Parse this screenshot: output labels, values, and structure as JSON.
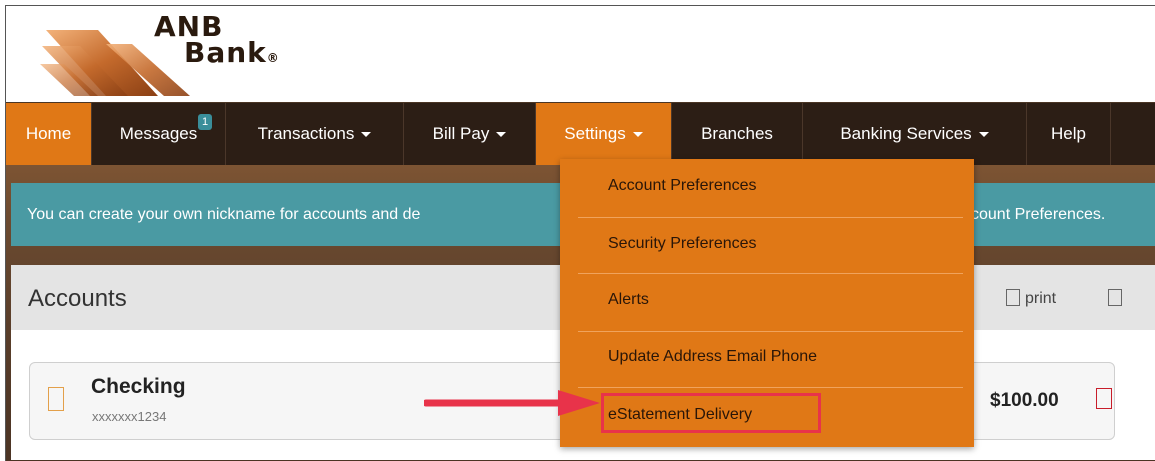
{
  "header": {
    "logo_line1": "ANB",
    "logo_line2": "Bank",
    "logo_reg": "®"
  },
  "nav": {
    "home": "Home",
    "messages": "Messages",
    "messages_badge": "1",
    "transactions": "Transactions",
    "bill_pay": "Bill Pay",
    "settings": "Settings",
    "branches": "Branches",
    "banking_services": "Banking Services",
    "help": "Help"
  },
  "alert": {
    "text_left": "You can create your own nickname for accounts and de",
    "text_right": "count Preferences."
  },
  "settings_menu": {
    "items": [
      "Account Preferences",
      "Security Preferences",
      "Alerts",
      "Update Address Email Phone",
      "eStatement Delivery"
    ],
    "highlighted_item": "eStatement Delivery"
  },
  "accounts": {
    "title": "Accounts",
    "print_label": "print",
    "list": [
      {
        "name": "Checking",
        "number": "xxxxxxx1234",
        "balance": "$100.00"
      }
    ]
  },
  "colors": {
    "nav_bg": "#2c1e15",
    "accent_orange": "#e07816",
    "alert_teal": "#4a9aa3",
    "callout_red": "#e8334a",
    "badge_teal": "#3a8e9a"
  },
  "icons": {
    "logo": "anb-swoosh-logo",
    "caret": "chevron-down-icon",
    "checkbox": "checkbox-icon",
    "arrow": "annotation-arrow"
  }
}
